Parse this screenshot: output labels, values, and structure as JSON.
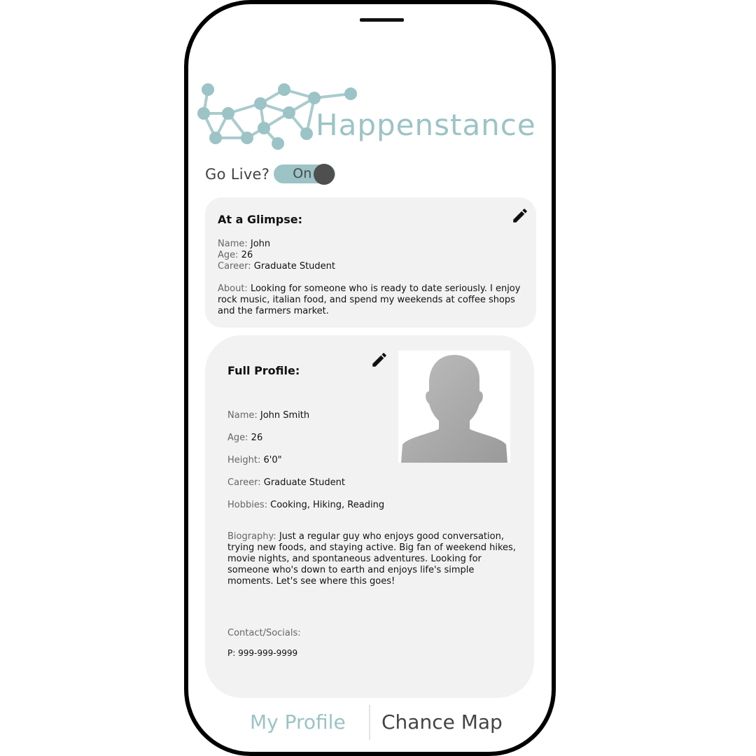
{
  "app": {
    "brand": "Happenstance",
    "accent_color": "#9cc3c6"
  },
  "go_live": {
    "label": "Go Live?",
    "toggle_text": "On",
    "state": "on"
  },
  "glimpse": {
    "title": "At a Glimpse:",
    "name_label": "Name:",
    "name_value": "John",
    "age_label": "Age:",
    "age_value": "26",
    "career_label": "Career:",
    "career_value": "Graduate Student",
    "about_label": "About:",
    "about_value": "Looking for someone who is ready to date seriously. I enjoy rock music, italian food, and spend my weekends at coffee shops and the farmers market.",
    "edit_icon": "pencil-icon"
  },
  "full_profile": {
    "title": "Full Profile:",
    "name_label": "Name:",
    "name_value": "John Smith",
    "age_label": "Age:",
    "age_value": "26",
    "height_label": "Height:",
    "height_value": "6'0\"",
    "career_label": "Career:",
    "career_value": "Graduate Student",
    "hobbies_label": "Hobbies:",
    "hobbies_value": "Cooking, Hiking, Reading",
    "biography_label": "Biography:",
    "biography_value": "Just a regular guy who enjoys good conversation, trying new foods, and staying active. Big fan of weekend hikes, movie nights, and spontaneous adventures. Looking for someone who's down to earth and enjoys life's simple moments. Let's see where this goes!",
    "contact_label": "Contact/Socials:",
    "phone": "P: 999-999-9999",
    "edit_icon": "pencil-icon",
    "avatar_icon": "person-silhouette-icon"
  },
  "nav": {
    "my_profile": "My Profile",
    "chance_map": "Chance Map",
    "active": "My Profile"
  }
}
